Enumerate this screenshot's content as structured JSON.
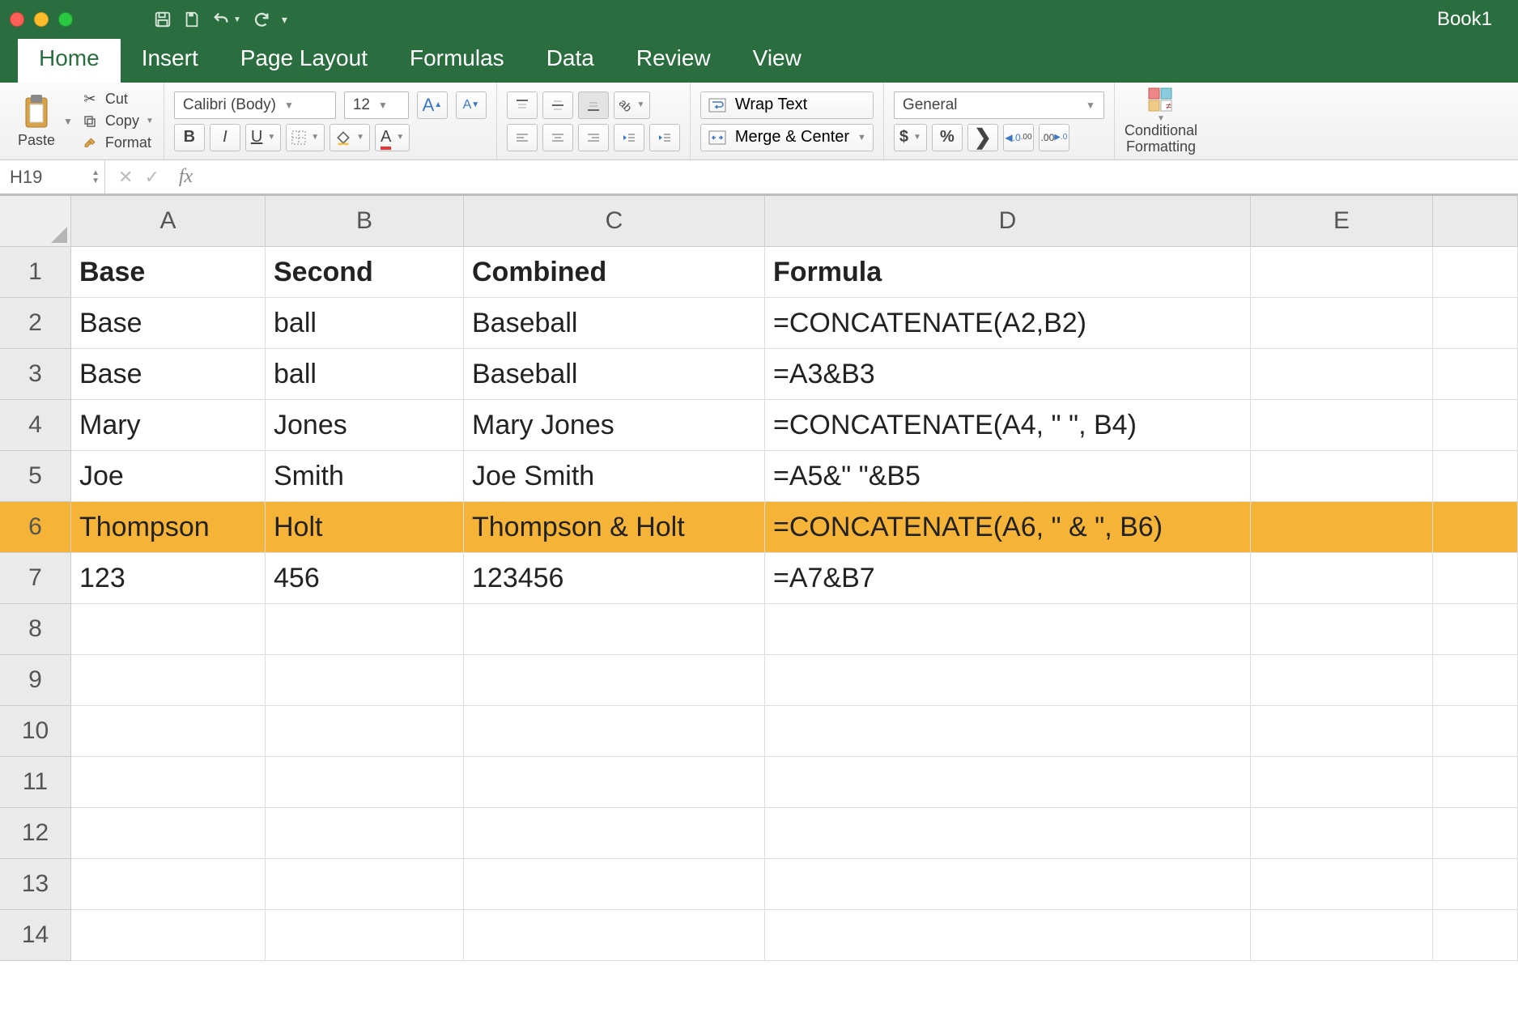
{
  "window": {
    "title": "Book1"
  },
  "ribbon_tabs": {
    "home": "Home",
    "insert": "Insert",
    "page_layout": "Page Layout",
    "formulas": "Formulas",
    "data": "Data",
    "review": "Review",
    "view": "View"
  },
  "ribbon": {
    "paste": "Paste",
    "cut": "Cut",
    "copy": "Copy",
    "format_painter": "Format",
    "font_name": "Calibri (Body)",
    "font_size": "12",
    "wrap_text": "Wrap Text",
    "merge_center": "Merge & Center",
    "number_format": "General",
    "conditional_formatting_line1": "Conditional",
    "conditional_formatting_line2": "Formatting"
  },
  "formula_bar": {
    "name_box": "H19",
    "formula": ""
  },
  "grid": {
    "columns": [
      "A",
      "B",
      "C",
      "D",
      "E"
    ],
    "row_count": 14,
    "headers": {
      "A": "Base",
      "B": "Second",
      "C": "Combined",
      "D": "Formula"
    },
    "rows": [
      {
        "n": 2,
        "A": "Base",
        "B": "ball",
        "C": "Baseball",
        "D": "=CONCATENATE(A2,B2)",
        "hl": false
      },
      {
        "n": 3,
        "A": "Base",
        "B": "ball",
        "C": "Baseball",
        "D": "=A3&B3",
        "hl": false
      },
      {
        "n": 4,
        "A": "Mary",
        "B": "Jones",
        "C": "Mary Jones",
        "D": "=CONCATENATE(A4, \" \", B4)",
        "hl": false
      },
      {
        "n": 5,
        "A": "Joe",
        "B": "Smith",
        "C": "Joe Smith",
        "D": "=A5&\" \"&B5",
        "hl": false
      },
      {
        "n": 6,
        "A": "Thompson",
        "B": "Holt",
        "C": "Thompson & Holt",
        "D": "=CONCATENATE(A6, \" & \", B6)",
        "hl": true
      },
      {
        "n": 7,
        "A": "123",
        "B": "456",
        "C": "123456",
        "D": "=A7&B7",
        "hl": false
      }
    ],
    "highlight_color": "#f5b337"
  }
}
